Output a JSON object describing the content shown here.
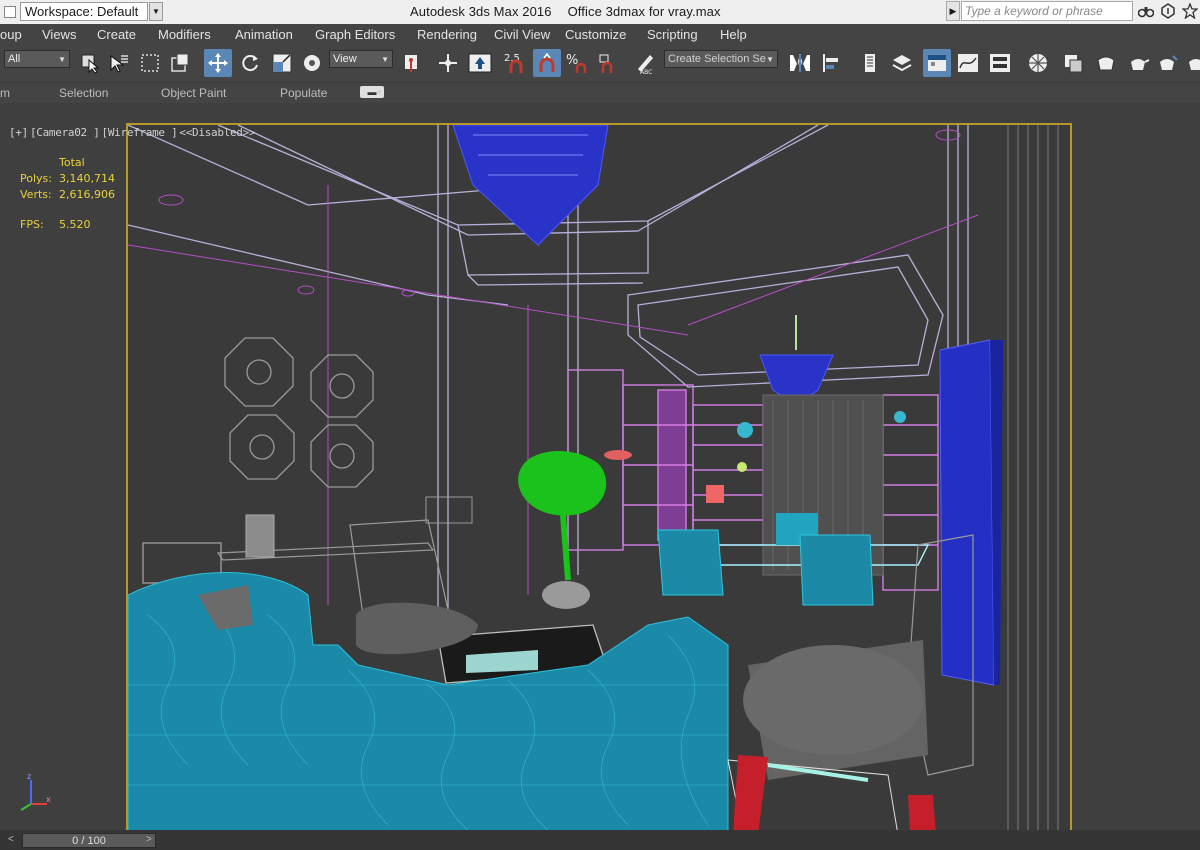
{
  "titlebar": {
    "workspace_label": "Workspace: Default",
    "app_name": "Autodesk 3ds Max 2016",
    "file_name": "Office 3dmax for vray.max",
    "search_placeholder": "Type a keyword or phrase"
  },
  "menu": {
    "items": [
      "oup",
      "Views",
      "Create",
      "Modifiers",
      "Animation",
      "Graph Editors",
      "Rendering",
      "Civil View",
      "Customize",
      "Scripting",
      "Help"
    ]
  },
  "toolbar": {
    "selection_filter": "All",
    "reference_coord": "View",
    "snap_value": "2.5",
    "named_selection_placeholder": "Create Selection Se"
  },
  "ribbon": {
    "tabs": [
      "m",
      "Selection",
      "Object Paint",
      "Populate"
    ]
  },
  "viewport": {
    "label_parts": [
      "[+]",
      "[Camera02 ]",
      "[Wireframe ]",
      "<<Disabled>>"
    ],
    "stats": {
      "total_label": "Total",
      "polys_label": "Polys:",
      "polys_value": "3,140,714",
      "verts_label": "Verts:",
      "verts_value": "2,616,906",
      "fps_label": "FPS:",
      "fps_value": "5.520"
    },
    "axis_labels": {
      "x": "x",
      "z": "z"
    }
  },
  "timeline": {
    "frame_display": "0 / 100"
  },
  "colors": {
    "viewport_border": "#b59a2a",
    "stats_text": "#e8d23a",
    "active_button": "#5b87b7"
  }
}
